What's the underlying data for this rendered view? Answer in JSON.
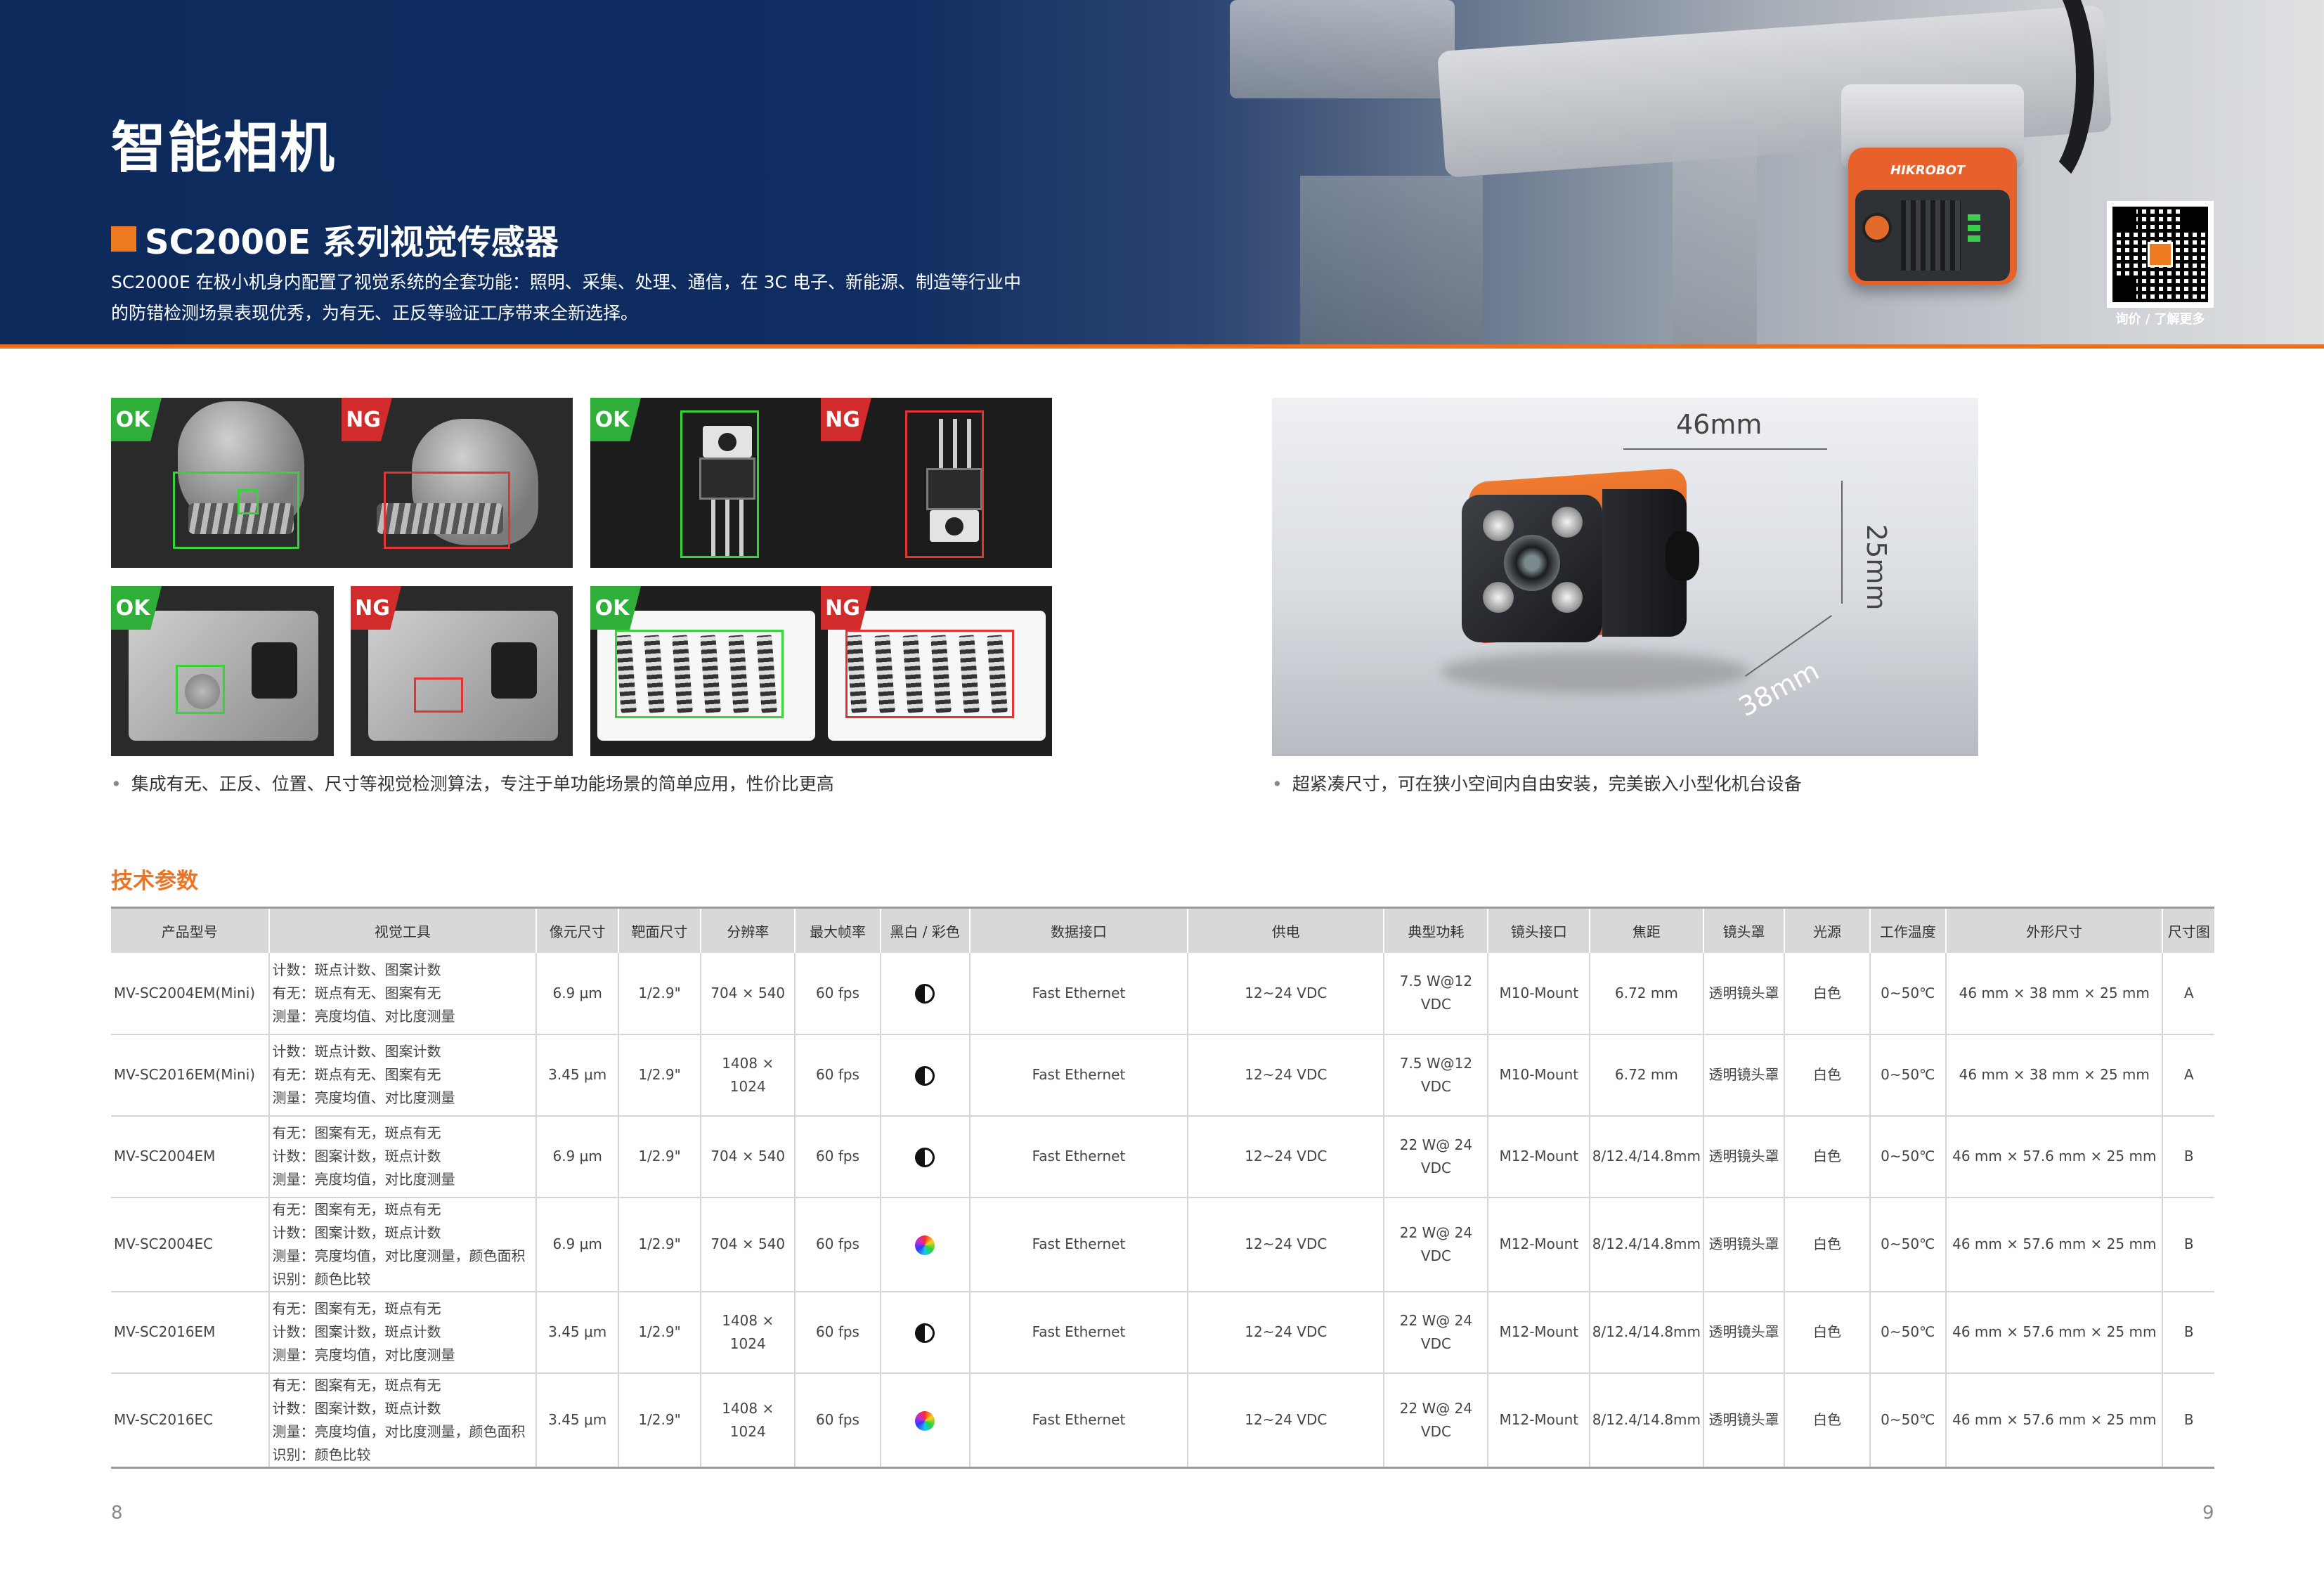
{
  "header": {
    "page_title": "智能相机",
    "series_title": "SC2000E 系列视觉传感器",
    "intro_line1": "SC2000E 在极小机身内配置了视觉系统的全套功能：照明、采集、处理、通信，在 3C 电子、新能源、制造等行业中",
    "intro_line2": "的防错检测场景表现优秀，为有无、正反等验证工序带来全新选择。",
    "camera_brand": "HIKROBOT",
    "qr_caption": "询价 / 了解更多",
    "accent_color": "#ee6e1f",
    "banner_color": "#0f2d62"
  },
  "samples": {
    "ok_label": "OK",
    "ng_label": "NG",
    "caption": "集成有无、正反、位置、尺寸等视觉检测算法，专注于单功能场景的简单应用，性价比更高"
  },
  "product_photo": {
    "width_label": "46mm",
    "height_label": "25mm",
    "depth_label": "38mm",
    "caption": "超紧凑尺寸，可在狭小空间内自由安装，完美嵌入小型化机台设备"
  },
  "spec": {
    "heading": "技术参数",
    "columns": [
      "产品型号",
      "视觉工具",
      "像元尺寸",
      "靶面尺寸",
      "分辨率",
      "最大帧率",
      "黑白 / 彩色",
      "数据接口",
      "供电",
      "典型功耗",
      "镜头接口",
      "焦距",
      "镜头罩",
      "光源",
      "工作温度",
      "外形尺寸",
      "尺寸图"
    ],
    "rows": [
      {
        "model": "MV-SC2004EM(Mini)",
        "tools": [
          "计数：斑点计数、图案计数",
          "有无：斑点有无、图案有无",
          "测量：亮度均值、对比度测量"
        ],
        "pixel": "6.9 μm",
        "sensor": "1/2.9\"",
        "resolution": "704 × 540",
        "fps": "60 fps",
        "color": "mono",
        "interface": "Fast Ethernet",
        "power": "12~24 VDC",
        "consumption": "7.5 W@12 VDC",
        "mount": "M10-Mount",
        "focal": "6.72 mm",
        "cover": "透明镜头罩",
        "light": "白色",
        "temp": "0~50℃",
        "dims": "46 mm × 38 mm × 25 mm",
        "drawing": "A"
      },
      {
        "model": "MV-SC2016EM(Mini)",
        "tools": [
          "计数：斑点计数、图案计数",
          "有无：斑点有无、图案有无",
          "测量：亮度均值、对比度测量"
        ],
        "pixel": "3.45 μm",
        "sensor": "1/2.9\"",
        "resolution": "1408 × 1024",
        "fps": "60 fps",
        "color": "mono",
        "interface": "Fast Ethernet",
        "power": "12~24 VDC",
        "consumption": "7.5 W@12 VDC",
        "mount": "M10-Mount",
        "focal": "6.72 mm",
        "cover": "透明镜头罩",
        "light": "白色",
        "temp": "0~50℃",
        "dims": "46 mm × 38 mm × 25 mm",
        "drawing": "A"
      },
      {
        "model": "MV-SC2004EM",
        "tools": [
          "有无：图案有无，斑点有无",
          "计数：图案计数，斑点计数",
          "测量：亮度均值，对比度测量"
        ],
        "pixel": "6.9 μm",
        "sensor": "1/2.9\"",
        "resolution": "704 × 540",
        "fps": "60 fps",
        "color": "mono",
        "interface": "Fast Ethernet",
        "power": "12~24 VDC",
        "consumption": "22 W@ 24 VDC",
        "mount": "M12-Mount",
        "focal": "8/12.4/14.8mm",
        "cover": "透明镜头罩",
        "light": "白色",
        "temp": "0~50℃",
        "dims": "46 mm × 57.6 mm × 25 mm",
        "drawing": "B"
      },
      {
        "model": "MV-SC2004EC",
        "tools": [
          "有无：图案有无，斑点有无",
          "计数：图案计数，斑点计数",
          "测量：亮度均值，对比度测量，颜色面积",
          "识别：颜色比较"
        ],
        "pixel": "6.9 μm",
        "sensor": "1/2.9\"",
        "resolution": "704 × 540",
        "fps": "60 fps",
        "color": "color",
        "interface": "Fast Ethernet",
        "power": "12~24 VDC",
        "consumption": "22 W@ 24 VDC",
        "mount": "M12-Mount",
        "focal": "8/12.4/14.8mm",
        "cover": "透明镜头罩",
        "light": "白色",
        "temp": "0~50℃",
        "dims": "46 mm × 57.6 mm × 25 mm",
        "drawing": "B"
      },
      {
        "model": "MV-SC2016EM",
        "tools": [
          "有无：图案有无，斑点有无",
          "计数：图案计数，斑点计数",
          "测量：亮度均值，对比度测量"
        ],
        "pixel": "3.45 μm",
        "sensor": "1/2.9\"",
        "resolution": "1408 × 1024",
        "fps": "60 fps",
        "color": "mono",
        "interface": "Fast Ethernet",
        "power": "12~24 VDC",
        "consumption": "22 W@ 24 VDC",
        "mount": "M12-Mount",
        "focal": "8/12.4/14.8mm",
        "cover": "透明镜头罩",
        "light": "白色",
        "temp": "0~50℃",
        "dims": "46 mm × 57.6 mm × 25 mm",
        "drawing": "B"
      },
      {
        "model": "MV-SC2016EC",
        "tools": [
          "有无：图案有无，斑点有无",
          "计数：图案计数，斑点计数",
          "测量：亮度均值，对比度测量，颜色面积",
          "识别：颜色比较"
        ],
        "pixel": "3.45 μm",
        "sensor": "1/2.9\"",
        "resolution": "1408 × 1024",
        "fps": "60 fps",
        "color": "color",
        "interface": "Fast Ethernet",
        "power": "12~24 VDC",
        "consumption": "22 W@ 24 VDC",
        "mount": "M12-Mount",
        "focal": "8/12.4/14.8mm",
        "cover": "透明镜头罩",
        "light": "白色",
        "temp": "0~50℃",
        "dims": "46 mm × 57.6 mm × 25 mm",
        "drawing": "B"
      }
    ]
  },
  "footer": {
    "page_left": "8",
    "page_right": "9"
  }
}
